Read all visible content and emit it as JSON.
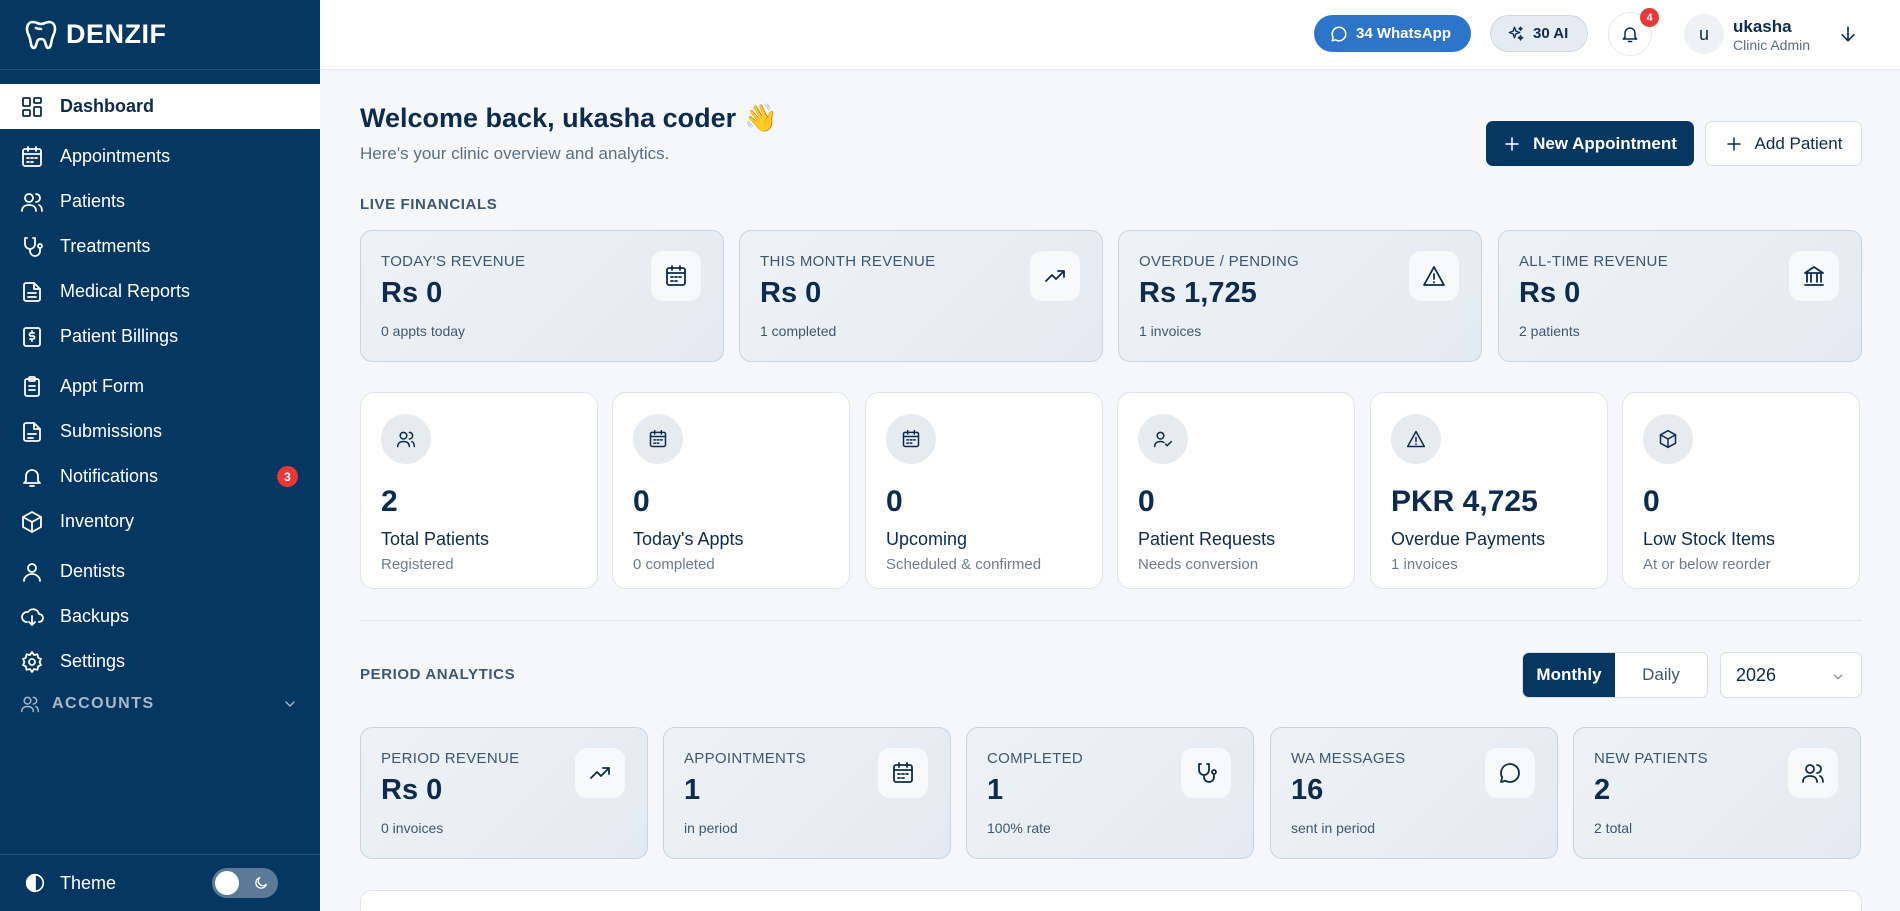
{
  "brand": {
    "name": "DENZIF"
  },
  "sidebar": {
    "items": [
      {
        "label": "Dashboard",
        "icon": "grid-icon"
      },
      {
        "label": "Appointments",
        "icon": "calendar-icon"
      },
      {
        "label": "Patients",
        "icon": "users-icon"
      },
      {
        "label": "Treatments",
        "icon": "stethoscope-icon"
      },
      {
        "label": "Medical Reports",
        "icon": "file-text-icon"
      },
      {
        "label": "Patient Billings",
        "icon": "receipt-icon"
      },
      {
        "label": "Appt Form",
        "icon": "clipboard-icon"
      },
      {
        "label": "Submissions",
        "icon": "file-icon"
      },
      {
        "label": "Notifications",
        "icon": "bell-icon",
        "badge": "3"
      },
      {
        "label": "Inventory",
        "icon": "box-icon"
      },
      {
        "label": "Dentists",
        "icon": "user-icon"
      },
      {
        "label": "Backups",
        "icon": "cloud-download-icon"
      },
      {
        "label": "Settings",
        "icon": "gear-icon"
      }
    ],
    "accounts_label": "ACCOUNTS",
    "theme_label": "Theme"
  },
  "topbar": {
    "whatsapp_label": "34 WhatsApp",
    "ai_label": "30 AI",
    "notification_count": "4",
    "avatar_initial": "u",
    "user_name": "ukasha",
    "user_role": "Clinic Admin"
  },
  "header": {
    "welcome": "Welcome back, ukasha coder",
    "wave_emoji": "👋",
    "subtitle": "Here's your clinic overview and analytics.",
    "new_appointment_label": "New Appointment",
    "add_patient_label": "Add Patient"
  },
  "live_financials": {
    "label": "LIVE FINANCIALS",
    "cards": [
      {
        "label": "TODAY'S REVENUE",
        "value": "Rs 0",
        "sub": "0 appts today",
        "icon": "calendar-icon"
      },
      {
        "label": "THIS MONTH REVENUE",
        "value": "Rs 0",
        "sub": "1 completed",
        "icon": "trending-up-icon"
      },
      {
        "label": "OVERDUE / PENDING",
        "value": "Rs 1,725",
        "sub": "1 invoices",
        "icon": "alert-triangle-icon"
      },
      {
        "label": "ALL-TIME REVENUE",
        "value": "Rs 0",
        "sub": "2 patients",
        "icon": "bank-icon"
      }
    ]
  },
  "stats": [
    {
      "value": "2",
      "label": "Total Patients",
      "sub": "Registered",
      "icon": "users-icon"
    },
    {
      "value": "0",
      "label": "Today's Appts",
      "sub": "0 completed",
      "icon": "calendar-icon"
    },
    {
      "value": "0",
      "label": "Upcoming",
      "sub": "Scheduled & confirmed",
      "icon": "calendar-icon"
    },
    {
      "value": "0",
      "label": "Patient Requests",
      "sub": "Needs conversion",
      "icon": "user-check-icon"
    },
    {
      "value": "PKR 4,725",
      "label": "Overdue Payments",
      "sub": "1 invoices",
      "icon": "alert-triangle-icon"
    },
    {
      "value": "0",
      "label": "Low Stock Items",
      "sub": "At or below reorder",
      "icon": "box-icon"
    }
  ],
  "period_analytics": {
    "label": "PERIOD ANALYTICS",
    "toggle": {
      "monthly": "Monthly",
      "daily": "Daily",
      "selected": "Monthly"
    },
    "year": "2026",
    "cards": [
      {
        "label": "PERIOD REVENUE",
        "value": "Rs 0",
        "sub": "0 invoices",
        "icon": "trending-up-icon"
      },
      {
        "label": "APPOINTMENTS",
        "value": "1",
        "sub": "in period",
        "icon": "calendar-icon"
      },
      {
        "label": "COMPLETED",
        "value": "1",
        "sub": "100% rate",
        "icon": "stethoscope-icon"
      },
      {
        "label": "WA MESSAGES",
        "value": "16",
        "sub": "sent in period",
        "icon": "message-circle-icon"
      },
      {
        "label": "NEW PATIENTS",
        "value": "2",
        "sub": "2 total",
        "icon": "users-icon"
      }
    ]
  },
  "colors": {
    "sidebar": "#063763",
    "accent": "#2e75c9",
    "badge": "#e53935"
  }
}
